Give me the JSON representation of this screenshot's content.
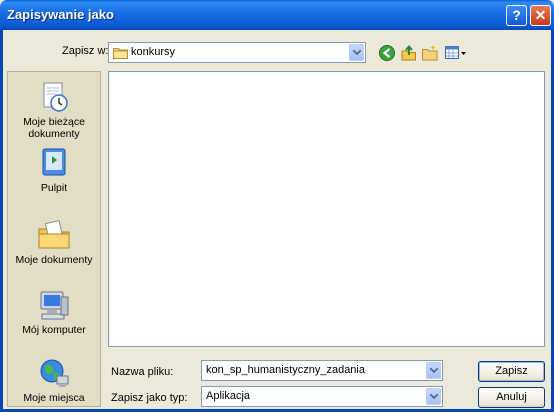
{
  "window": {
    "title": "Zapisywanie jako"
  },
  "titlebar": {
    "help_glyph": "?",
    "close_glyph": "✕"
  },
  "save_in": {
    "label": "Zapisz w:",
    "value": "konkursy"
  },
  "toolbar": {
    "icons": [
      "back-icon",
      "up-folder-icon",
      "new-folder-icon",
      "view-menu-icon"
    ]
  },
  "places": [
    {
      "label": "Moje bieżące dokumenty",
      "icon": "recent-documents-icon"
    },
    {
      "label": "Pulpit",
      "icon": "desktop-icon"
    },
    {
      "label": "Moje dokumenty",
      "icon": "my-documents-icon"
    },
    {
      "label": "Mój komputer",
      "icon": "my-computer-icon"
    },
    {
      "label": "Moje miejsca",
      "icon": "network-places-icon"
    }
  ],
  "file_list": {
    "items": []
  },
  "form": {
    "filename_label": "Nazwa pliku:",
    "filename_value": "kon_sp_humanistyczny_zadania",
    "filetype_label": "Zapisz jako typ:",
    "filetype_value": "Aplikacja"
  },
  "buttons": {
    "save": "Zapisz",
    "cancel": "Anuluj"
  },
  "colors": {
    "titlebar": "#0b58d2",
    "dialog_bg": "#ece9d8",
    "places_bg": "#e2ddc5",
    "field_border": "#7f9db9"
  }
}
